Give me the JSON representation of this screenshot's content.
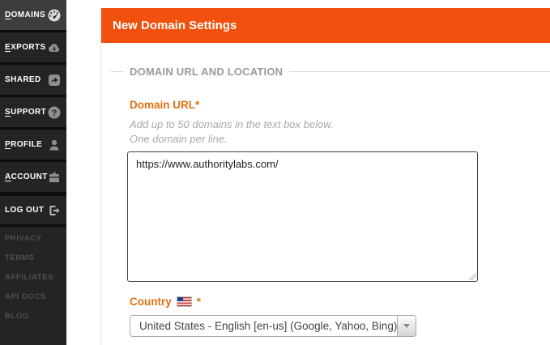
{
  "colors": {
    "header_orange": "#f1500e",
    "label_orange": "#e2700f",
    "sidebar_bg": "#242424",
    "sidebar_active_bg": "#3d3d3d",
    "sidebar_separator": "#0d0d0d"
  },
  "sidebar": {
    "items": [
      {
        "label": "DOMAINS",
        "icon": "gauge-icon",
        "active": true,
        "separated": false,
        "underline_first": true
      },
      {
        "label": "EXPORTS",
        "icon": "cloud-download-icon",
        "active": false,
        "separated": false,
        "underline_first": true
      },
      {
        "label": "SHARED",
        "icon": "share-icon",
        "active": false,
        "separated": false,
        "underline_first": false
      },
      {
        "label": "SUPPORT",
        "icon": "help-icon",
        "active": false,
        "separated": false,
        "underline_first": true
      },
      {
        "label": "PROFILE",
        "icon": "user-icon",
        "active": false,
        "separated": false,
        "underline_first": true
      },
      {
        "label": "ACCOUNT",
        "icon": "briefcase-icon",
        "active": false,
        "separated": false,
        "underline_first": true
      },
      {
        "label": "LOG OUT",
        "icon": "logout-icon",
        "active": false,
        "separated": true,
        "underline_first": false
      }
    ],
    "footer_links": [
      "PRIVACY",
      "TERMS",
      "AFFILIATES",
      "API DOCS",
      "BLOG"
    ]
  },
  "form": {
    "header_title": "New Domain Settings",
    "section_title": "DOMAIN URL AND LOCATION",
    "domain_url": {
      "label": "Domain URL",
      "required_marker": "*",
      "help_lines": [
        "Add up to 50 domains in the text box below.",
        "One domain per line."
      ],
      "value": "https://www.authoritylabs.com/"
    },
    "country": {
      "label": "Country",
      "flag_icon": "us-flag-icon",
      "required_marker": "*",
      "selected_option": "United States - English [en-us] (Google, Yahoo, Bing)"
    }
  }
}
